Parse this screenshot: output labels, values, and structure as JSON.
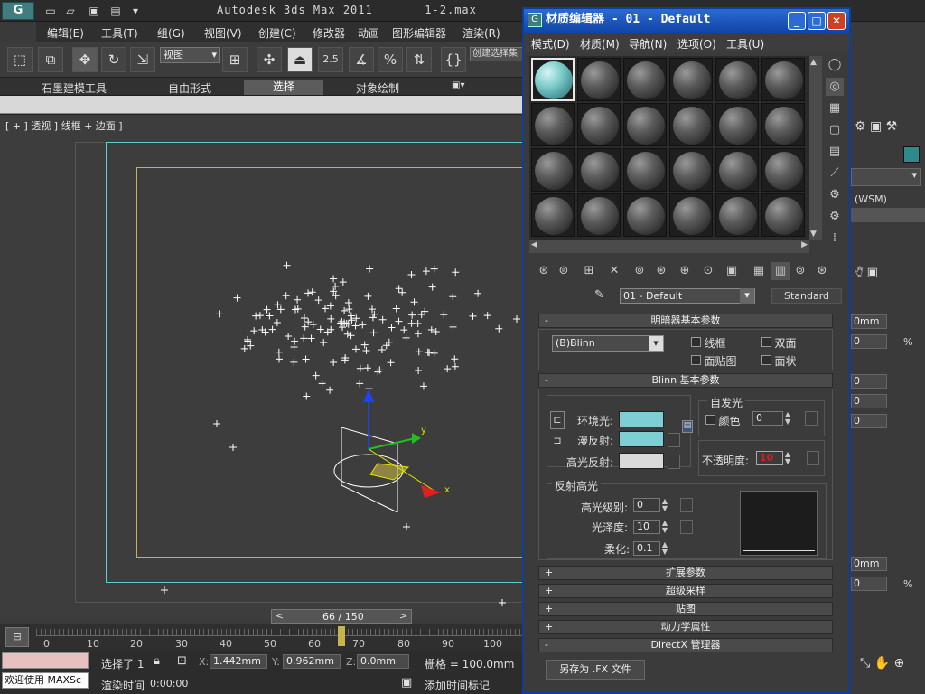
{
  "app": {
    "title": "Autodesk 3ds Max  2011",
    "file": "1-2.max",
    "logo": "G"
  },
  "quickaccess": [
    "new-icon",
    "open-icon",
    "save-icon",
    "project-icon",
    "dropdown-icon"
  ],
  "menu": [
    "编辑(E)",
    "工具(T)",
    "组(G)",
    "视图(V)",
    "创建(C)",
    "修改器",
    "动画",
    "图形编辑器",
    "渲染(R)"
  ],
  "toolbar": {
    "view_select": "视图",
    "snap_value": "2.5",
    "selection_set": "创建选择集"
  },
  "ribbon": {
    "tabs": [
      "石墨建模工具",
      "自由形式",
      "选择",
      "对象绘制"
    ],
    "active": "选择"
  },
  "viewport": {
    "label": "[ + ] 透视 ] 线框 + 边面 ]",
    "axis_x": "x",
    "axis_y": "y"
  },
  "timeline": {
    "slider": "66 / 150",
    "ticks": [
      "0",
      "10",
      "20",
      "30",
      "40",
      "50",
      "60",
      "70",
      "80",
      "90",
      "100"
    ]
  },
  "status": {
    "selected": "选择了 1",
    "x_label": "X:",
    "x_value": "1.442mm",
    "y_label": "Y:",
    "y_value": "0.962mm",
    "z_label": "Z:",
    "z_value": "0.0mm",
    "grid": "栅格 = 100.0mm",
    "welcome": "欢迎使用 MAXSc",
    "render_time_label": "渲染时间",
    "render_time": "0:00:00",
    "add_time_tag": "添加时间标记"
  },
  "material_editor": {
    "title": "材质编辑器 - 01 - Default",
    "menu": [
      "模式(D)",
      "材质(M)",
      "导航(N)",
      "选项(O)",
      "工具(U)"
    ],
    "slot_rows": 4,
    "slot_cols": 6,
    "material_name": "01 - Default",
    "material_type": "Standard",
    "shader_rollup": "明暗器基本参数",
    "shader": "(B)Blinn",
    "wire": "线框",
    "two_sided": "双面",
    "face_map": "面贴图",
    "faceted": "面状",
    "blinn_rollup": "Blinn 基本参数",
    "self_illum": "自发光",
    "color_label": "颜色",
    "self_illum_value": "0",
    "ambient": "环境光:",
    "diffuse": "漫反射:",
    "specular": "高光反射:",
    "opacity_label": "不透明度:",
    "opacity_value": "10",
    "spec_section": "反射高光",
    "spec_level_label": "高光级别:",
    "spec_level": "0",
    "gloss_label": "光泽度:",
    "gloss": "10",
    "soften_label": "柔化:",
    "soften": "0.1",
    "rollups": [
      "扩展参数",
      "超级采样",
      "贴图",
      "动力学属性",
      "DirectX 管理器"
    ],
    "save_fx": "另存为 .FX 文件",
    "colors": {
      "ambient": "#7ecfd3",
      "diffuse": "#7ecfd3",
      "specular": "#d9d9d9"
    }
  },
  "right_panel": {
    "wsm": "(WSM)",
    "fields": [
      "0mm",
      "0",
      "%",
      "0",
      "0",
      "0",
      "0mm",
      "0",
      "%"
    ]
  }
}
